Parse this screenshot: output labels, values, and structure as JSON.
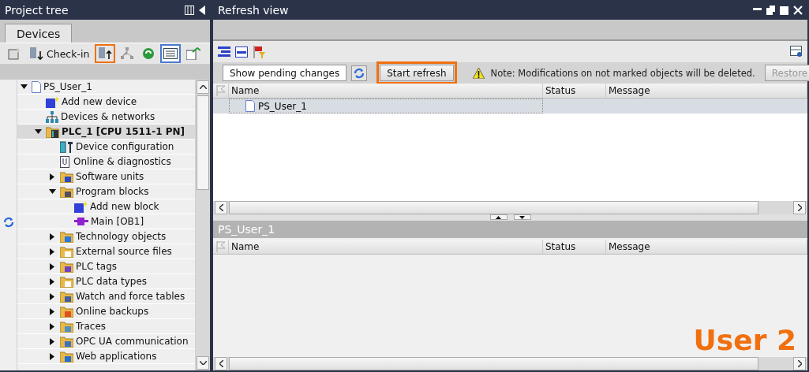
{
  "project_tree": {
    "title": "Project tree",
    "tabs": [
      {
        "label": "Devices",
        "selected": true
      }
    ],
    "toolbar": [
      {
        "kind": "icon",
        "highlighted": false,
        "pressed": false
      },
      {
        "kind": "labeled",
        "label": "Check-in",
        "highlighted": false,
        "pressed": false
      },
      {
        "kind": "icon",
        "highlighted": true,
        "pressed": false
      },
      {
        "kind": "icon",
        "highlighted": false,
        "pressed": false
      },
      {
        "kind": "icon",
        "highlighted": false,
        "pressed": false
      },
      {
        "kind": "icon",
        "highlighted": false,
        "pressed": true
      },
      {
        "kind": "icon",
        "highlighted": false,
        "pressed": false
      }
    ],
    "items": [
      {
        "label": "PS_User_1",
        "expanded": true,
        "selected": false,
        "refresh_mark": false,
        "children": [
          {
            "label": "Add new device",
            "selected": false,
            "refresh_mark": false
          },
          {
            "label": "Devices & networks",
            "selected": false,
            "refresh_mark": false
          },
          {
            "label": "PLC_1 [CPU 1511-1 PN]",
            "expanded": true,
            "selected": true,
            "refresh_mark": false,
            "children": [
              {
                "label": "Device configuration",
                "selected": false,
                "refresh_mark": false
              },
              {
                "label": "Online & diagnostics",
                "selected": false,
                "refresh_mark": false
              },
              {
                "label": "Software units",
                "expanded": false,
                "selected": false,
                "refresh_mark": false
              },
              {
                "label": "Program blocks",
                "expanded": true,
                "selected": false,
                "refresh_mark": false,
                "children": [
                  {
                    "label": "Add new block",
                    "selected": false,
                    "refresh_mark": false
                  },
                  {
                    "label": "Main [OB1]",
                    "selected": false,
                    "refresh_mark": true
                  }
                ]
              },
              {
                "label": "Technology objects",
                "expanded": false,
                "selected": false,
                "refresh_mark": false
              },
              {
                "label": "External source files",
                "expanded": false,
                "selected": false,
                "refresh_mark": false
              },
              {
                "label": "PLC tags",
                "expanded": false,
                "selected": false,
                "refresh_mark": false
              },
              {
                "label": "PLC data types",
                "expanded": false,
                "selected": false,
                "refresh_mark": false
              },
              {
                "label": "Watch and force tables",
                "expanded": false,
                "selected": false,
                "refresh_mark": false
              },
              {
                "label": "Online backups",
                "expanded": false,
                "selected": false,
                "refresh_mark": false
              },
              {
                "label": "Traces",
                "expanded": false,
                "selected": false,
                "refresh_mark": false
              },
              {
                "label": "OPC UA communication",
                "expanded": false,
                "selected": false,
                "refresh_mark": false
              },
              {
                "label": "Web applications",
                "expanded": false,
                "selected": false,
                "refresh_mark": false
              }
            ]
          }
        ]
      }
    ]
  },
  "refresh_view": {
    "title": "Refresh view",
    "action_bar": {
      "pending_button": "Show pending changes",
      "start_button": {
        "label": "Start refresh",
        "highlighted": true
      },
      "note": "Note: Modifications on not marked objects will be deleted.",
      "restore_button": {
        "label": "Restore",
        "disabled": true
      }
    },
    "top_table": {
      "columns": [
        "Name",
        "Status",
        "Message"
      ],
      "rows": [
        {
          "name": "PS_User_1",
          "selected": true
        }
      ]
    },
    "bottom_section": {
      "title": "PS_User_1",
      "columns": [
        "Name",
        "Status",
        "Message"
      ]
    }
  },
  "annotation": "User 2"
}
